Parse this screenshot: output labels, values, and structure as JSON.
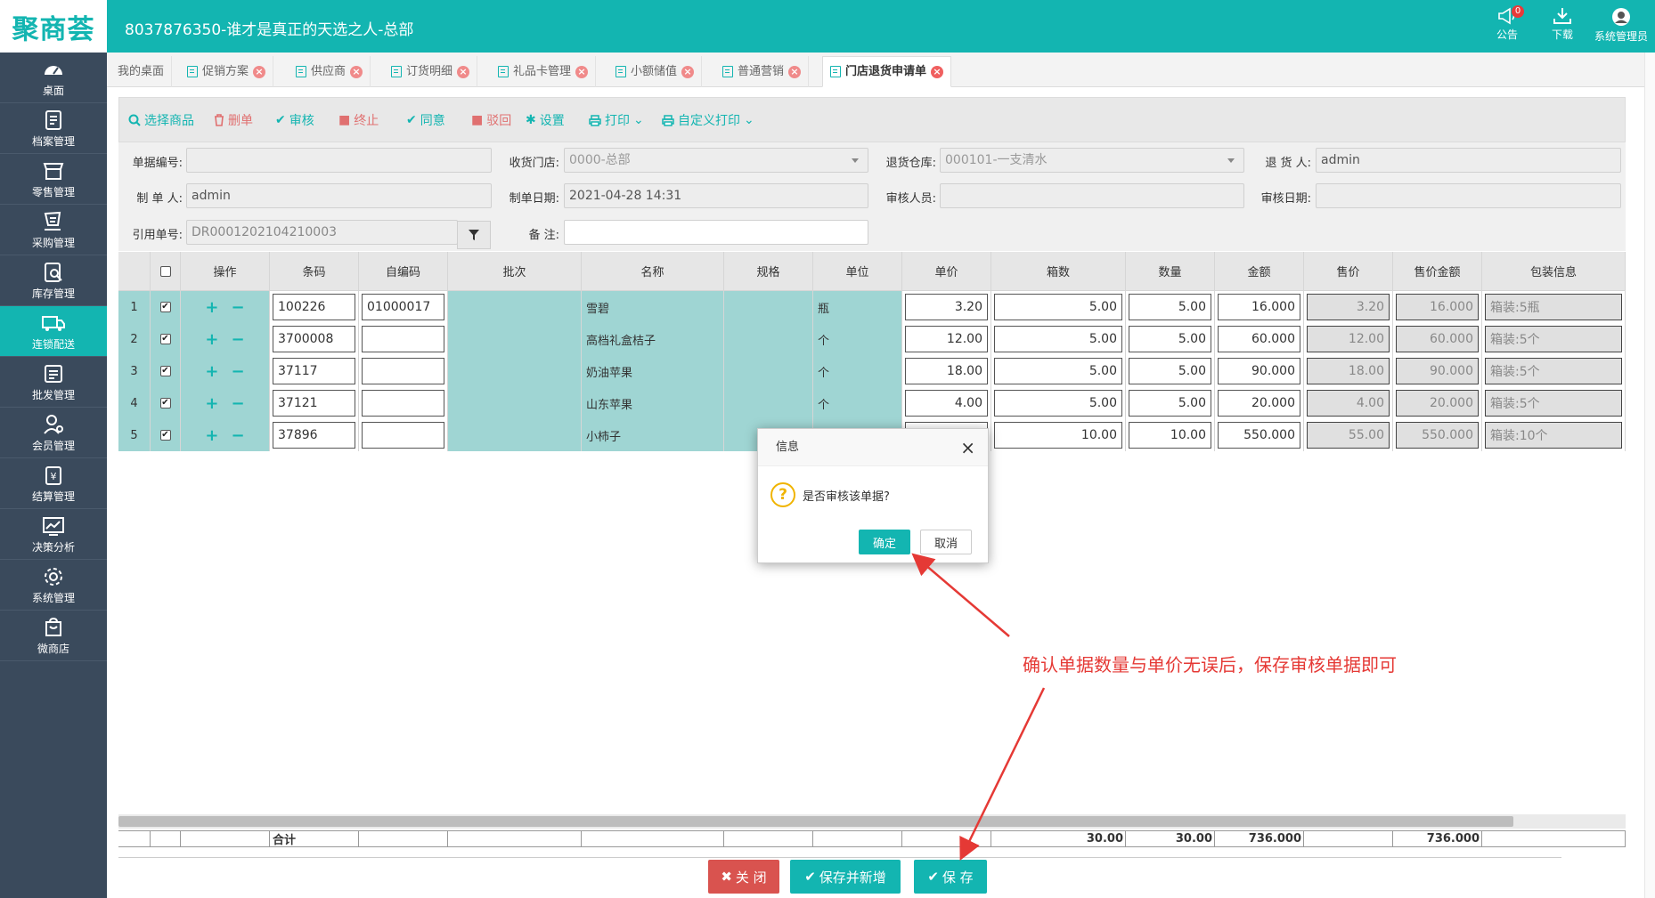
{
  "app": {
    "logo_text": "聚商荟",
    "window_title": "8037876350-谁才是真正的天选之人-总部"
  },
  "header": {
    "notice_label": "公告",
    "notice_count": "0",
    "download_label": "下载",
    "user_label": "系统管理员"
  },
  "sidebar": {
    "items": [
      {
        "label": "桌面",
        "icon": "dashboard-icon"
      },
      {
        "label": "档案管理",
        "icon": "archive-icon"
      },
      {
        "label": "零售管理",
        "icon": "store-icon"
      },
      {
        "label": "采购管理",
        "icon": "purchase-icon"
      },
      {
        "label": "库存管理",
        "icon": "inventory-icon"
      },
      {
        "label": "连锁配送",
        "icon": "delivery-icon",
        "active": true
      },
      {
        "label": "批发管理",
        "icon": "wholesale-icon"
      },
      {
        "label": "会员管理",
        "icon": "member-icon"
      },
      {
        "label": "结算管理",
        "icon": "settlement-icon"
      },
      {
        "label": "决策分析",
        "icon": "analysis-icon"
      },
      {
        "label": "系统管理",
        "icon": "settings-icon"
      },
      {
        "label": "微商店",
        "icon": "shop-icon"
      }
    ]
  },
  "tabs": [
    {
      "label": "我的桌面"
    },
    {
      "label": "促销方案"
    },
    {
      "label": "供应商"
    },
    {
      "label": "订货明细"
    },
    {
      "label": "礼品卡管理"
    },
    {
      "label": "小额储值"
    },
    {
      "label": "普通营销"
    },
    {
      "label": "门店退货申请单",
      "active": true
    }
  ],
  "toolbar": {
    "select_goods": "选择商品",
    "delete": "删单",
    "audit": "审核",
    "terminate": "终止",
    "agree": "同意",
    "reject": "驳回",
    "settings": "设置",
    "print": "打印",
    "custom_print": "自定义打印"
  },
  "form": {
    "doc_no_label": "单据编号:",
    "doc_no_value": "",
    "receive_store_label": "收货门店:",
    "receive_store_value": "0000-总部",
    "return_wh_label": "退货仓库:",
    "return_wh_value": "000101-一支清水",
    "returner_label": "退 货 人:",
    "returner_value": "admin",
    "maker_label": "制 单 人:",
    "maker_value": "admin",
    "make_date_label": "制单日期:",
    "make_date_value": "2021-04-28 14:31",
    "auditor_label": "审核人员:",
    "auditor_value": "",
    "audit_date_label": "审核日期:",
    "audit_date_value": "",
    "ref_no_label": "引用单号:",
    "ref_no_value": "DR0001202104210003",
    "remark_label": "备    注:",
    "remark_value": ""
  },
  "table": {
    "headers": [
      "操作",
      "条码",
      "自编码",
      "批次",
      "名称",
      "规格",
      "单位",
      "单价",
      "箱数",
      "数量",
      "金额",
      "售价",
      "售价金额",
      "包装信息"
    ],
    "rows": [
      {
        "idx": "1",
        "barcode": "100226",
        "selfcode": "01000017",
        "batch": "",
        "name": "雪碧",
        "spec": "",
        "unit": "瓶",
        "price": "3.20",
        "boxes": "5.00",
        "qty": "5.00",
        "amount": "16.000",
        "sale_price": "3.20",
        "sale_amount": "16.000",
        "pack": "箱装:5瓶"
      },
      {
        "idx": "2",
        "barcode": "3700008",
        "selfcode": "",
        "batch": "",
        "name": "高档礼盒桔子",
        "spec": "",
        "unit": "个",
        "price": "12.00",
        "boxes": "5.00",
        "qty": "5.00",
        "amount": "60.000",
        "sale_price": "12.00",
        "sale_amount": "60.000",
        "pack": "箱装:5个"
      },
      {
        "idx": "3",
        "barcode": "37117",
        "selfcode": "",
        "batch": "",
        "name": "奶油苹果",
        "spec": "",
        "unit": "个",
        "price": "18.00",
        "boxes": "5.00",
        "qty": "5.00",
        "amount": "90.000",
        "sale_price": "18.00",
        "sale_amount": "90.000",
        "pack": "箱装:5个"
      },
      {
        "idx": "4",
        "barcode": "37121",
        "selfcode": "",
        "batch": "",
        "name": "山东苹果",
        "spec": "",
        "unit": "个",
        "price": "4.00",
        "boxes": "5.00",
        "qty": "5.00",
        "amount": "20.000",
        "sale_price": "4.00",
        "sale_amount": "20.000",
        "pack": "箱装:5个"
      },
      {
        "idx": "5",
        "barcode": "37896",
        "selfcode": "",
        "batch": "",
        "name": "小柿子",
        "spec": "",
        "unit": "",
        "price": "",
        "boxes": "10.00",
        "qty": "10.00",
        "amount": "550.000",
        "sale_price": "55.00",
        "sale_amount": "550.000",
        "pack": "箱装:10个"
      }
    ],
    "summary": {
      "label": "合计",
      "boxes": "30.00",
      "qty": "30.00",
      "amount": "736.000",
      "sale_amount": "736.000"
    }
  },
  "footer": {
    "close": "关 闭",
    "save_new": "保存并新增",
    "save": "保 存"
  },
  "dialog": {
    "title": "信息",
    "message": "是否审核该单据?",
    "ok": "确定",
    "cancel": "取消"
  },
  "annotation": "确认单据数量与单价无误后，保存审核单据即可",
  "colors": {
    "accent": "#13b5b1",
    "sidebar_bg": "#3a4a5c",
    "danger": "#d9534f",
    "annotation": "#e53935",
    "row_highlight": "#9fd5d3"
  }
}
